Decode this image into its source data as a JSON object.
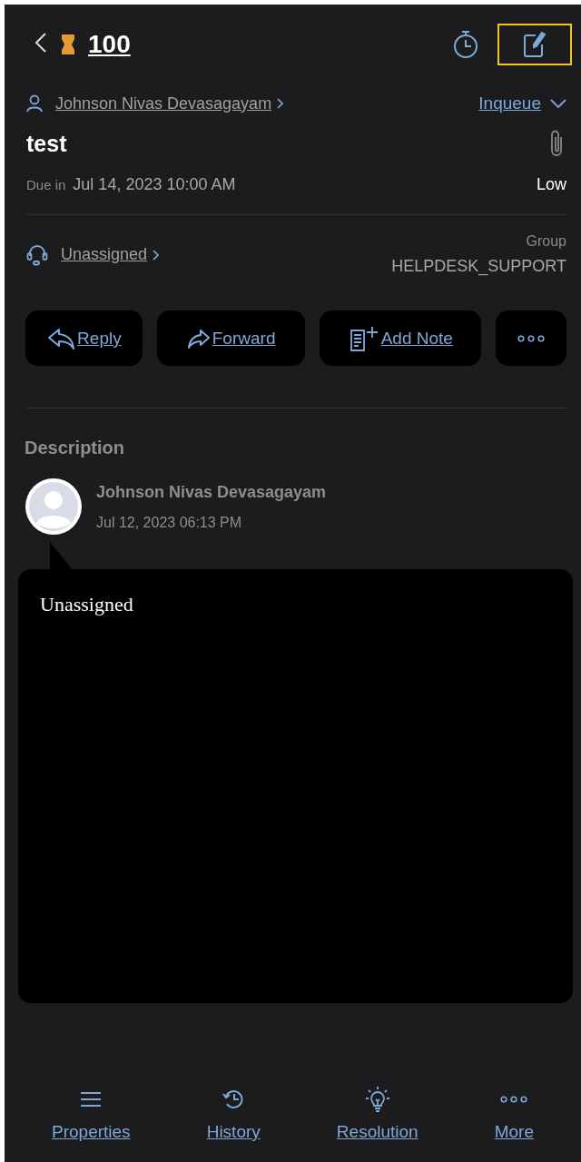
{
  "header": {
    "ticket_number": "100",
    "edit_highlighted": true
  },
  "requester": {
    "name": "Johnson Nivas Devasagayam",
    "status": "Inqueue"
  },
  "ticket": {
    "subject": "test",
    "due_label": "Due in",
    "due_date": "Jul 14, 2023 10:00 AM",
    "priority": "Low"
  },
  "assignment": {
    "agent": "Unassigned",
    "group_label": "Group",
    "group": "HELPDESK_SUPPORT"
  },
  "actions": [
    {
      "kind": "reply",
      "label": "Reply"
    },
    {
      "kind": "forward",
      "label": "Forward"
    },
    {
      "kind": "note",
      "label": "Add Note"
    },
    {
      "kind": "more"
    }
  ],
  "description": {
    "title": "Description",
    "author": "Johnson Nivas Devasagayam",
    "time": "Jul 12, 2023 06:13 PM",
    "body": "Unassigned"
  },
  "tab_bar": [
    {
      "kind": "properties",
      "label": "Properties"
    },
    {
      "kind": "history",
      "label": "History"
    },
    {
      "kind": "resolution",
      "label": "Resolution"
    },
    {
      "kind": "more",
      "label": "More"
    }
  ]
}
